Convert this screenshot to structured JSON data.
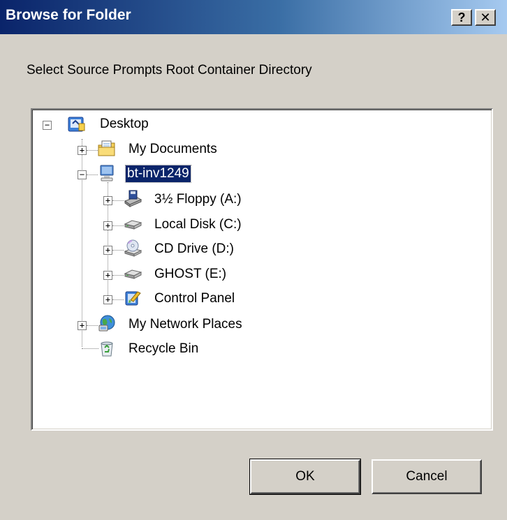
{
  "window": {
    "title": "Browse for Folder",
    "help_label": "?",
    "close_label": "✕"
  },
  "prompt": "Select Source Prompts Root Container Directory",
  "tree": {
    "root": {
      "label": "Desktop",
      "icon": "desktop-icon",
      "expander": "−"
    },
    "my_documents": {
      "label": "My Documents",
      "icon": "folder-documents-icon",
      "expander": "+"
    },
    "computer": {
      "label": "bt-inv1249",
      "icon": "computer-icon",
      "expander": "−",
      "selected": true
    },
    "floppy": {
      "label": "3½ Floppy (A:)",
      "icon": "floppy-drive-icon",
      "expander": "+"
    },
    "local_disk": {
      "label": "Local Disk (C:)",
      "icon": "hard-disk-icon",
      "expander": "+"
    },
    "cd_drive": {
      "label": "CD Drive (D:)",
      "icon": "cd-drive-icon",
      "expander": "+"
    },
    "ghost": {
      "label": "GHOST (E:)",
      "icon": "hard-disk-icon",
      "expander": "+"
    },
    "control_panel": {
      "label": "Control Panel",
      "icon": "control-panel-icon",
      "expander": "+"
    },
    "network": {
      "label": "My Network Places",
      "icon": "network-places-icon",
      "expander": "+"
    },
    "recycle": {
      "label": "Recycle Bin",
      "icon": "recycle-bin-icon"
    }
  },
  "buttons": {
    "ok": "OK",
    "cancel": "Cancel"
  },
  "colors": {
    "title_bar_start": "#0a246a",
    "title_bar_end": "#a6caf0",
    "dialog_face": "#d4d0c8",
    "selection": "#0a246a"
  }
}
